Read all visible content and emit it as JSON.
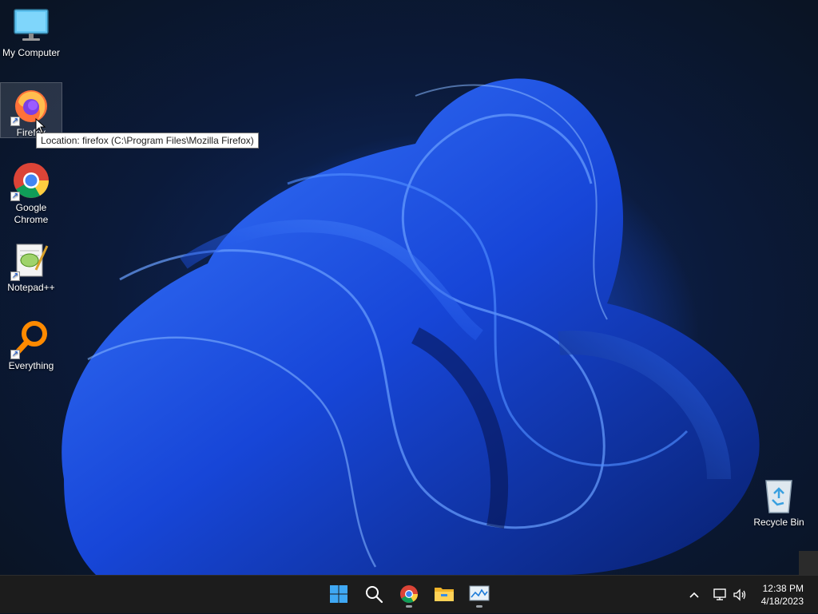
{
  "desktop": {
    "icons": [
      {
        "label": "My Computer"
      },
      {
        "label": "Firefox"
      },
      {
        "label": "Google Chrome"
      },
      {
        "label": "Notepad++"
      },
      {
        "label": "Everything"
      },
      {
        "label": "Recycle Bin"
      }
    ],
    "tooltip": "Location: firefox (C:\\Program Files\\Mozilla Firefox)"
  },
  "taskbar": {
    "apps": [
      "start-icon",
      "search-icon",
      "chrome-icon",
      "file-explorer-icon",
      "task-manager-icon"
    ],
    "tray": [
      "chevron-up-icon",
      "network-icon",
      "volume-icon"
    ],
    "clock": {
      "time": "12:38 PM",
      "date": "4/18/2023"
    }
  },
  "colors": {
    "accent": "#1d4fd8",
    "taskbar": "#1c1c1c"
  }
}
